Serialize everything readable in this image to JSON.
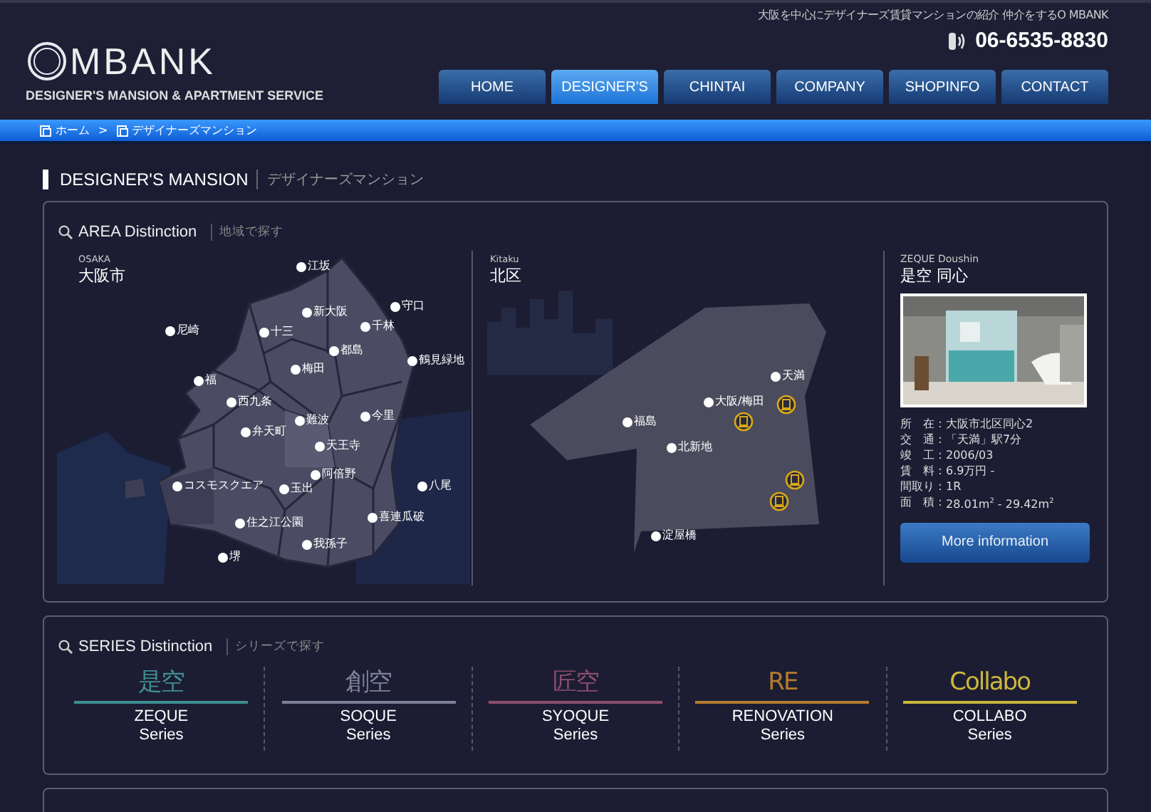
{
  "header": {
    "tagline": "大阪を中心にデザイナーズ賃貸マンションの紹介 仲介をするO MBANK",
    "phone": "06-6535-8830",
    "logo": "MBANK",
    "logo_subtitle": "DESIGNER'S MANSION & APARTMENT SERVICE"
  },
  "nav": [
    {
      "label": "HOME",
      "selected": false
    },
    {
      "label": "DESIGNER'S",
      "selected": true
    },
    {
      "label": "CHINTAI",
      "selected": false
    },
    {
      "label": "COMPANY",
      "selected": false
    },
    {
      "label": "SHOPINFO",
      "selected": false
    },
    {
      "label": "CONTACT",
      "selected": false
    }
  ],
  "breadcrumb": [
    {
      "label": "ホーム"
    },
    {
      "label": "デザイナーズマンション"
    }
  ],
  "breadcrumb_separator": ">",
  "page_heading": {
    "title": "DESIGNER'S MANSION",
    "subtitle": "デザイナーズマンション"
  },
  "area": {
    "title": "AREA Distinction",
    "subtitle": "地域で探す",
    "city": {
      "caption": "OSAKA",
      "name": "大阪市",
      "locations": [
        "江坂",
        "新大阪",
        "守口",
        "尼崎",
        "十三",
        "千林",
        "都島",
        "鶴見緑地",
        "梅田",
        "福",
        "西九条",
        "難波",
        "今里",
        "弁天町",
        "天王寺",
        "阿倍野",
        "コスモスクエア",
        "玉出",
        "八尾",
        "住之江公園",
        "喜連瓜破",
        "我孫子",
        "堺"
      ]
    },
    "ward": {
      "caption": "Kitaku",
      "name": "北区",
      "locations": [
        "天満",
        "大阪/梅田",
        "福島",
        "北新地",
        "淀屋橋"
      ]
    },
    "property": {
      "caption": "ZEQUE  Doushin",
      "name": "是空 同心",
      "details": [
        {
          "label": "所　在",
          "value": "大阪市北区同心2"
        },
        {
          "label": "交　通",
          "value": "「天満」駅7分"
        },
        {
          "label": "竣　工",
          "value": "2006/03"
        },
        {
          "label": "賃　料",
          "value": "6.9万円 -"
        },
        {
          "label": "間取り",
          "value": "1R"
        },
        {
          "label": "面　積",
          "value": "28.01m$^{2}$ - 29.42m$^{2}$"
        }
      ],
      "separator": ":",
      "button": "More information"
    }
  },
  "series": {
    "title": "SERIES Distinction",
    "subtitle": "シリーズで探す",
    "items": [
      {
        "logo": "是空",
        "name": "ZEQUE",
        "suffix": "Series",
        "color": "#3f8d92"
      },
      {
        "logo": "創空",
        "name": "SOQUE",
        "suffix": "Series",
        "color": "#7c8098"
      },
      {
        "logo": "匠空",
        "name": "SYOQUE",
        "suffix": "Series",
        "color": "#8c4d6c"
      },
      {
        "logo": "RE",
        "name": "RENOVATION",
        "suffix": "Series",
        "color": "#b47d2c"
      },
      {
        "logo": "Collabo",
        "name": "COLLABO",
        "suffix": "Series",
        "color": "#cbb73c"
      }
    ]
  }
}
